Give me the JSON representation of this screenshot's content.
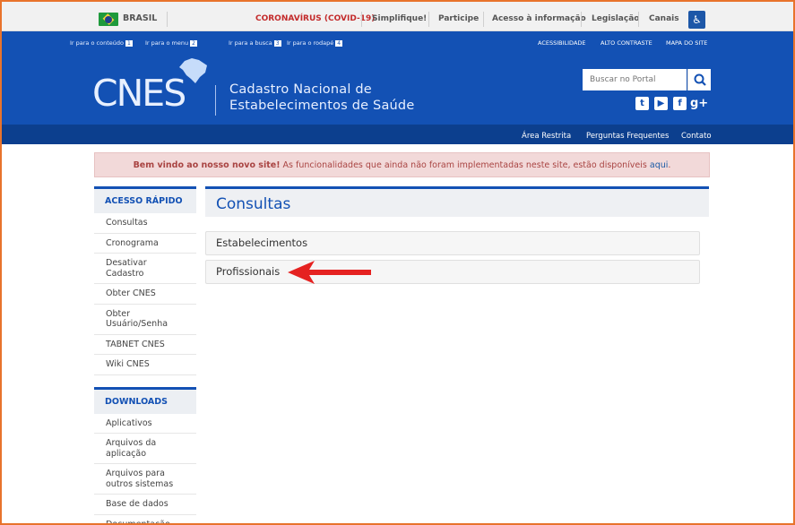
{
  "govbar": {
    "country": "BRASIL",
    "links": [
      "CORONAVÍRUS (COVID-19)",
      "Simplifique!",
      "Participe",
      "Acesso à informação",
      "Legislação",
      "Canais"
    ]
  },
  "header": {
    "skip_links": [
      "Ir para o conteúdo",
      "Ir para o menu",
      "Ir para a busca",
      "Ir para o rodapé"
    ],
    "skip_numbers": [
      "1",
      "2",
      "3",
      "4"
    ],
    "top_links": [
      "ACESSIBILIDADE",
      "ALTO CONTRASTE",
      "MAPA DO SITE"
    ],
    "logo": "CNES",
    "tagline_line1": "Cadastro Nacional de",
    "tagline_line2": "Estabelecimentos de Saúde",
    "search_placeholder": "Buscar no Portal",
    "social": [
      "twitter-icon",
      "youtube-icon",
      "facebook-icon",
      "google-plus-icon"
    ],
    "bottom_links": [
      "Área Restrita",
      "Perguntas Frequentes",
      "Contato"
    ]
  },
  "welcome": {
    "bold": "Bem vindo ao nosso novo site!",
    "text": " As funcionalidades que ainda não foram implementadas neste site, estão disponíveis ",
    "link": "aqui",
    "end": "."
  },
  "sidebar": {
    "quick_title": "ACESSO RÁPIDO",
    "quick_items": [
      "Consultas",
      "Cronograma",
      "Desativar Cadastro",
      "Obter CNES",
      "Obter Usuário/Senha",
      "TABNET CNES",
      "Wiki CNES"
    ],
    "downloads_title": "DOWNLOADS",
    "download_items": [
      "Aplicativos",
      "Arquivos da aplicação",
      "Arquivos para outros sistemas",
      "Base de dados",
      "Documentação"
    ]
  },
  "main": {
    "title": "Consultas",
    "items": [
      "Estabelecimentos",
      "Profissionais"
    ]
  },
  "colors": {
    "header_blue": "#1351b4",
    "arrow_red": "#e52221",
    "frame_orange": "#e8732c"
  }
}
